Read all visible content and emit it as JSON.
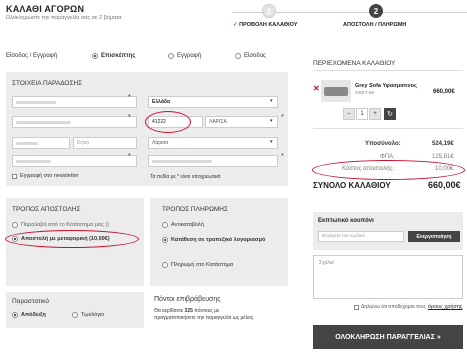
{
  "header": {
    "title": "ΚΑΛΑΘΙ ΑΓΟΡΩΝ",
    "subtitle": "Ολοκληρώστε την παραγγελία σας σε 2 βήματα",
    "steps": [
      {
        "number": "1",
        "label": "ΠΡΟΒΟΛΗ ΚΑΛΑΘΙΟΥ"
      },
      {
        "number": "2",
        "label": "ΑΠΟΣΤΟΛΗ / ΠΛΗΡΩΜΗ"
      }
    ]
  },
  "login": {
    "label": "Είσοδος / Εγγραφή",
    "options": [
      "Επισκέπτης",
      "Εγγραφή",
      "Είσοδος"
    ]
  },
  "details": {
    "title": "ΣΤΟΙΧΕΙΑ ΠΑΡΑΔΟΣΗΣ",
    "country": "Ελλάδα",
    "postcode": "41222",
    "city": "ΛΑΡΙΣΑ",
    "area_placeholder": "Κητιό",
    "region": "Λάρισα",
    "newsletter": "Εγγραφή στο newsletter",
    "required_note": "Τα πεδία με * είναι υποχρεωτικά"
  },
  "shipping": {
    "title": "ΤΡΟΠΟΣ ΑΠΟΣΤΟΛΗΣ",
    "options": [
      "Παραλαβή από το Κατάστημα μας ()",
      "Αποστολή με μεταφορική (10,00€)"
    ]
  },
  "payment": {
    "title": "ΤΡΟΠΟΣ ΠΛΗΡΩΜΗΣ",
    "options": [
      "Αντικαταβολή",
      "Κατάθεση σε τραπεζικό λογαριασμό",
      "Πληρωμή στο Κατάστημα"
    ]
  },
  "invoice": {
    "title": "Παραστατικό",
    "options": [
      "Απόδειξη",
      "Τιμολόγιο"
    ]
  },
  "loyalty": {
    "title": "Πόντοι επιβράβευσης",
    "text_prefix": "Θα κερδίσετε ",
    "points": "325",
    "text_suffix": " πόντους με",
    "text_line2": "πραγματοποιήσετε την παραγγελία ως μέλος"
  },
  "cart": {
    "title": "ΠΕΡΙΕΧΟΜΕΝΑ ΚΑΛΑΘΙΟΥ",
    "item_name": "Grey Sofa Υφασματινος",
    "item_sku": "GREY-69",
    "item_price": "660,00€",
    "quantity": "1",
    "subtotal_label": "Υποσύνολο:",
    "subtotal": "524,19€",
    "vat_label": "ΦΠΑ:",
    "vat": "125,81€",
    "shipping_label": "Κόστος αποστολής:",
    "shipping_cost": "10,00€",
    "total_label": "ΣΥΝΟΛΟ ΚΑΛΑΘΙΟΥ",
    "total": "660,00€"
  },
  "coupon": {
    "title": "Εκπτωτικό κουπόνι",
    "placeholder": "Εισάγετε τον κωδικό",
    "button": "Ενεργοποίηση"
  },
  "comments": {
    "placeholder": "Σχόλια"
  },
  "terms": {
    "text": "Δηλώνω ότι αποδέχομαι τους",
    "link": "όρους χρήσης"
  },
  "checkout_button": "ΟΛΟΚΛΗΡΩΣΗ ΠΑΡΑΓΓΕΛΙΑΣ »",
  "colors": {
    "accent_red": "#c8102e",
    "success_green": "#3a9a3a",
    "dark": "#444444"
  }
}
